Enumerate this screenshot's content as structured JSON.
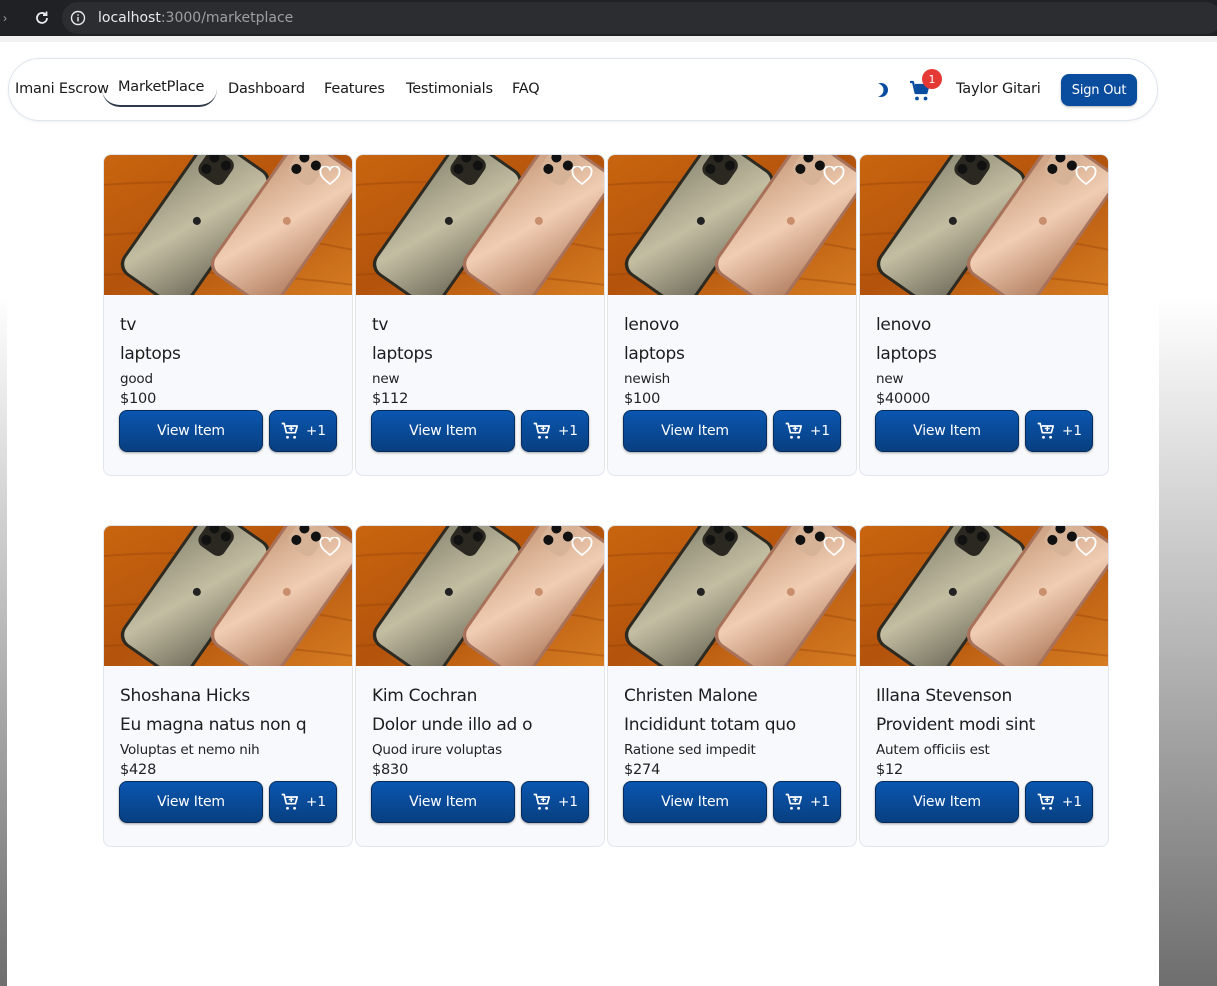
{
  "browser": {
    "url_host": "localhost",
    "url_path": ":3000/marketplace"
  },
  "navbar": {
    "brand": "Imani Escrow",
    "links": [
      "MarketPlace",
      "Dashboard",
      "Features",
      "Testimonials",
      "FAQ"
    ],
    "active_link": "MarketPlace",
    "cart_count": "1",
    "user_name": "Taylor Gitari",
    "signout_label": "Sign Out"
  },
  "buttons": {
    "view_item": "View Item",
    "add_to_cart": "+1"
  },
  "products": [
    {
      "title": "tv",
      "category": "laptops",
      "condition": "good",
      "price": "$100"
    },
    {
      "title": "tv",
      "category": "laptops",
      "condition": "new",
      "price": "$112"
    },
    {
      "title": "lenovo",
      "category": "laptops",
      "condition": "newish",
      "price": "$100"
    },
    {
      "title": "lenovo",
      "category": "laptops",
      "condition": "new",
      "price": "$40000"
    },
    {
      "title": "Shoshana Hicks",
      "category": "Eu magna natus non q",
      "condition": "Voluptas et nemo nih",
      "price": "$428"
    },
    {
      "title": "Kim Cochran",
      "category": "Dolor unde illo ad o",
      "condition": "Quod irure voluptas",
      "price": "$830"
    },
    {
      "title": "Christen Malone",
      "category": "Incididunt totam quo",
      "condition": "Ratione sed impedit",
      "price": "$274"
    },
    {
      "title": "Illana Stevenson",
      "category": "Provident modi sint",
      "condition": "Autem officiis est",
      "price": "$12"
    }
  ],
  "colors": {
    "primary": "#0a4d9e",
    "badge": "#e53935"
  }
}
